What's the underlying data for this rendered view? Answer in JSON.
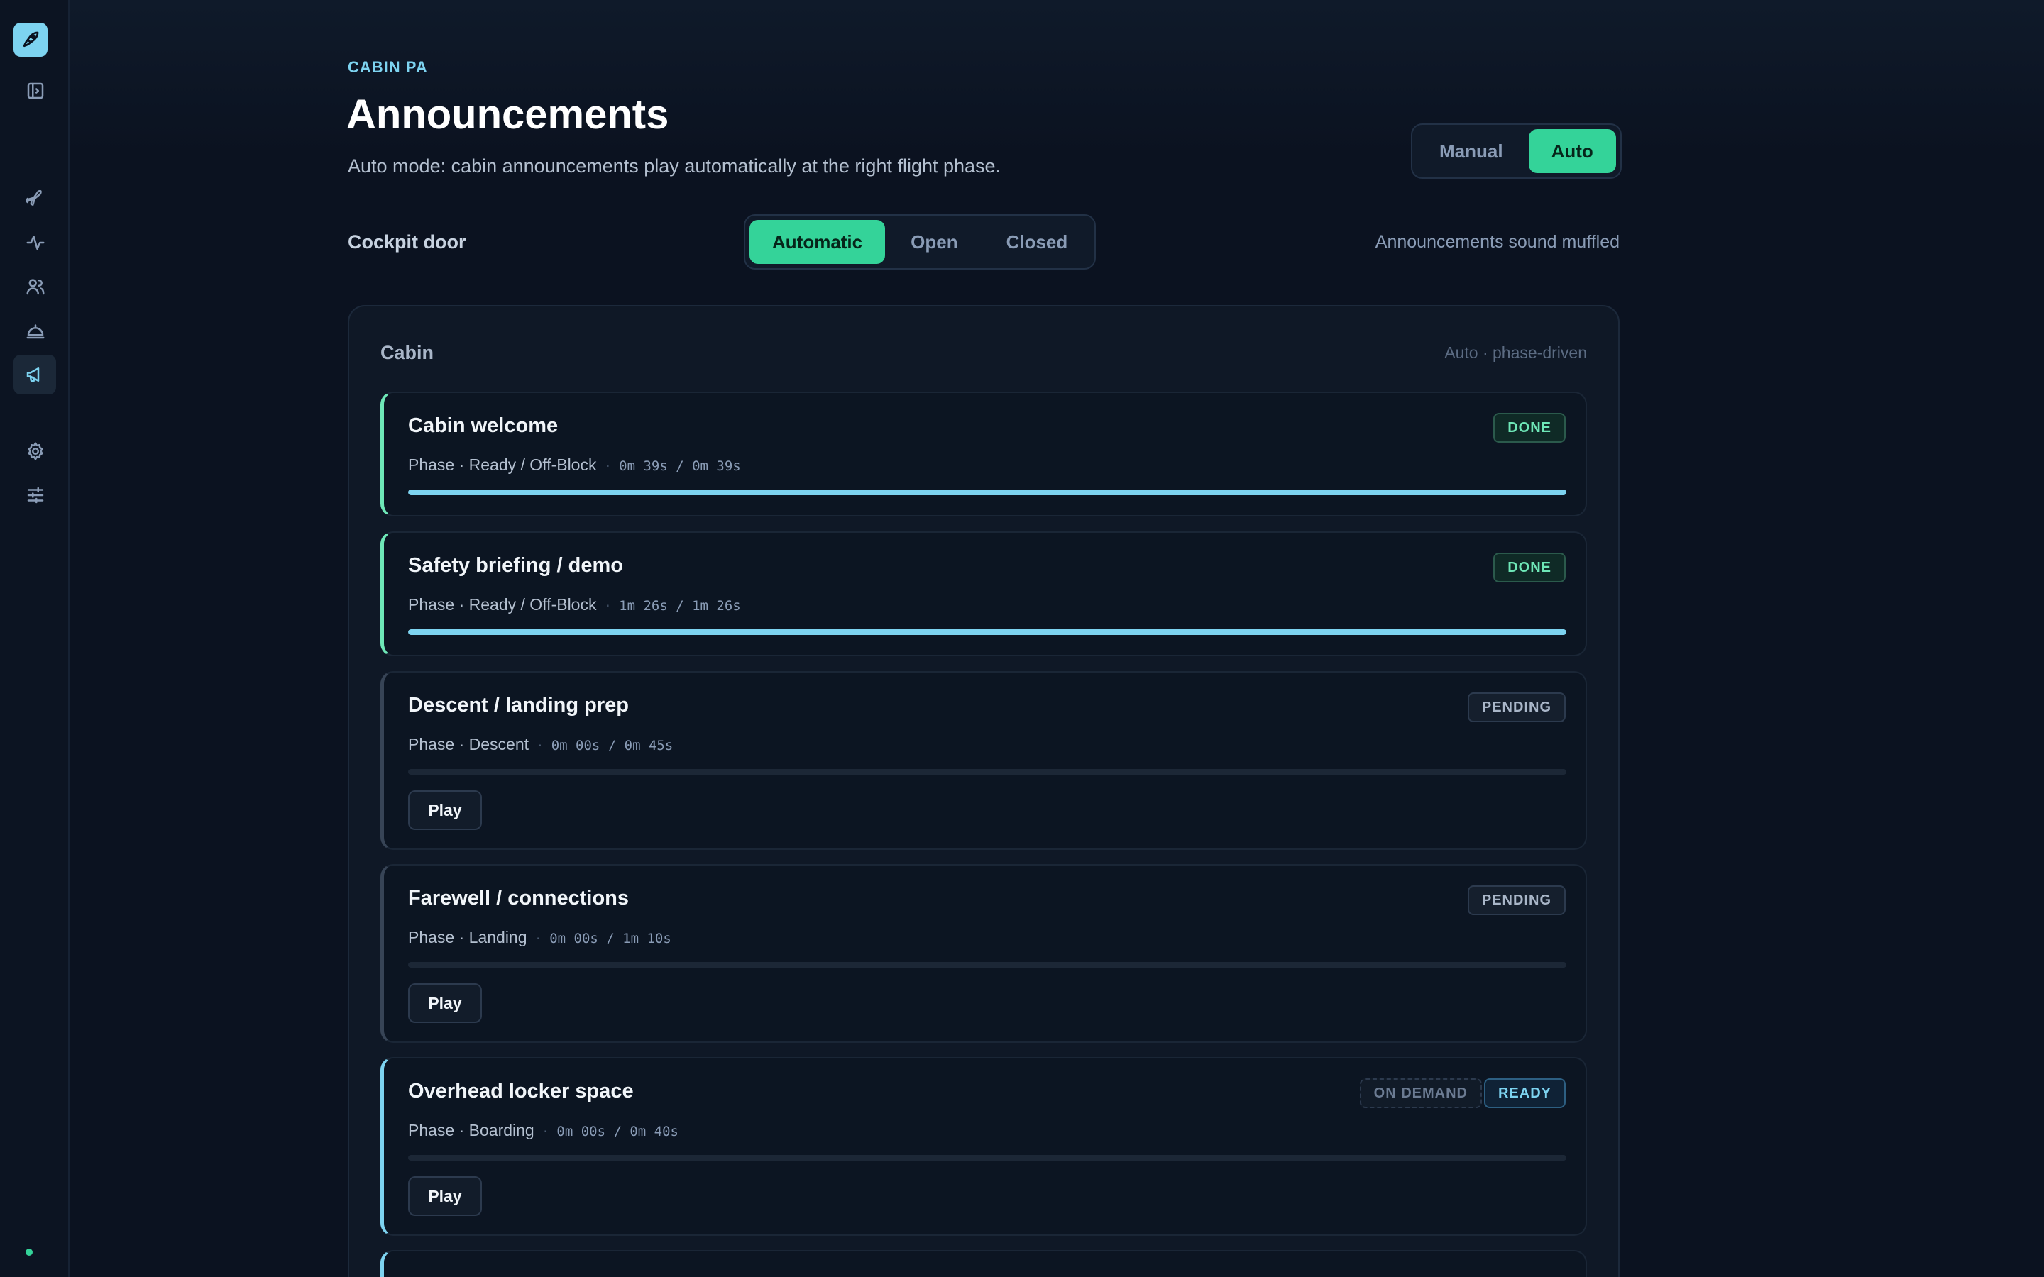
{
  "header": {
    "eyebrow": "CABIN PA",
    "title": "Announcements",
    "subtitle": "Auto mode: cabin announcements play automatically at the right flight phase."
  },
  "mode_toggle": {
    "options": [
      "Manual",
      "Auto"
    ],
    "selected": "Auto"
  },
  "cockpit_door": {
    "label": "Cockpit door",
    "options": [
      "Automatic",
      "Open",
      "Closed"
    ],
    "selected": "Automatic",
    "note": "Announcements sound muffled"
  },
  "sidebar": {
    "icons": [
      "rocket-logo",
      "sidebar-toggle-icon",
      "plane-icon",
      "activity-icon",
      "users-icon",
      "service-bell-icon",
      "megaphone-icon",
      "gear-icon",
      "sliders-icon"
    ],
    "active": "megaphone-icon",
    "status_color": "#34d399"
  },
  "panel": {
    "title": "Cabin",
    "meta": "Auto · phase-driven",
    "announcements": [
      {
        "title": "Cabin welcome",
        "phase": "Phase · Ready / Off-Block",
        "time": "0m 39s / 0m 39s",
        "status": "DONE",
        "progress": 1.0
      },
      {
        "title": "Safety briefing / demo",
        "phase": "Phase · Ready / Off-Block",
        "time": "1m 26s / 1m 26s",
        "status": "DONE",
        "progress": 1.0
      },
      {
        "title": "Descent / landing prep",
        "phase": "Phase · Descent",
        "time": "0m 00s / 0m 45s",
        "status": "PENDING",
        "progress": 0.0,
        "action": "Play"
      },
      {
        "title": "Farewell / connections",
        "phase": "Phase · Landing",
        "time": "0m 00s / 1m 10s",
        "status": "PENDING",
        "progress": 0.0,
        "action": "Play"
      },
      {
        "title": "Overhead locker space",
        "phase": "Phase · Boarding",
        "time": "0m 00s / 0m 40s",
        "status": "READY",
        "tag": "ON DEMAND",
        "progress": 0.0,
        "action": "Play"
      }
    ]
  },
  "colors": {
    "accent": "#34d399",
    "info": "#7dd3f0",
    "background": "#0b1220"
  }
}
